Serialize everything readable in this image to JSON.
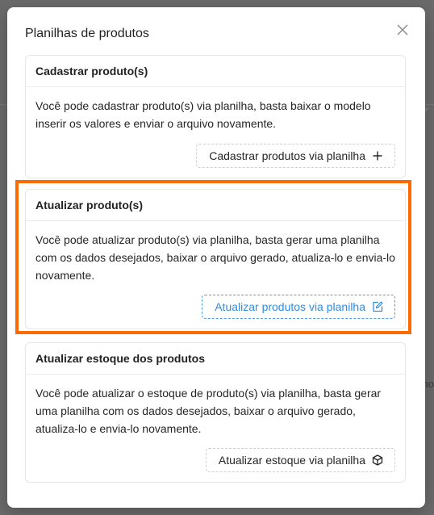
{
  "modal": {
    "title": "Planilhas de produtos"
  },
  "cards": [
    {
      "title": "Cadastrar produto(s)",
      "description": "Você pode cadastrar produto(s) via planilha, basta baixar o modelo inserir os valores e enviar o arquivo novamente.",
      "button_label": "Cadastrar produtos via planilha",
      "button_icon": "plus-icon"
    },
    {
      "title": "Atualizar produto(s)",
      "description": "Você pode atualizar produto(s) via planilha, basta gerar uma planilha com os dados desejados, baixar o arquivo gerado, atualiza-lo e envia-lo novamente.",
      "button_label": "Atualizar produtos via planilha",
      "button_icon": "edit-icon"
    },
    {
      "title": "Atualizar estoque dos produtos",
      "description": "Você pode atualizar o estoque de produto(s) via planilha, basta gerar uma planilha com os dados desejados, baixar o arquivo gerado, atualiza-lo e envia-lo novamente.",
      "button_label": "Atualizar estoque via planilha",
      "button_icon": "box-icon"
    }
  ],
  "background": {
    "partial_text": "no"
  },
  "colors": {
    "highlight": "#ff6a00",
    "primary": "#2f8ee0",
    "overlay": "#6b6b6b"
  }
}
